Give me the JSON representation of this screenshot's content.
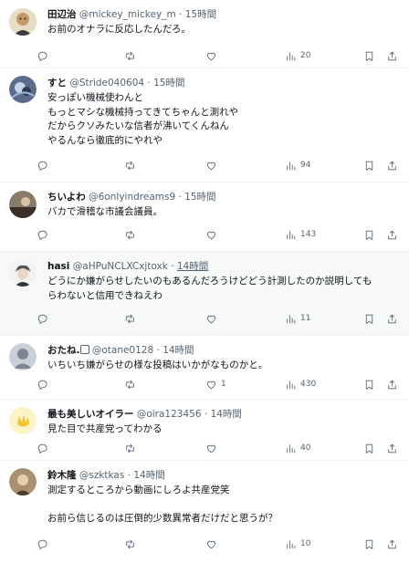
{
  "replies": [
    {
      "name": "田辺治",
      "handle": "@mickey_mickey_m",
      "dot": "·",
      "time": "15時間",
      "text": "お前のオナラに反応したんだろ。",
      "replies": "",
      "retweets": "",
      "likes": "",
      "views": "20"
    },
    {
      "name": "すと",
      "handle": "@Stride040604",
      "dot": "·",
      "time": "15時間",
      "text": "安っぽい機械使わんと\nもっとマシな機械持ってきてちゃんと測れや\nだからクソみたいな信者が沸いてくんねん\nやるんなら徹底的にやれや",
      "replies": "",
      "retweets": "",
      "likes": "",
      "views": "94"
    },
    {
      "name": "ちいよわ",
      "handle": "@6onlyindreams9",
      "dot": "·",
      "time": "15時間",
      "text": "バカで滑稽な市議会議員。",
      "replies": "",
      "retweets": "",
      "likes": "",
      "views": "143"
    },
    {
      "name": "hasi",
      "handle": "@aHPuNCLXCxjtoxk",
      "dot": "·",
      "time": "14時間",
      "text": "どうにか嫌がらせしたいのもあるんだろうけどどう計測したのか説明しても\nらわないと信用できねえわ",
      "replies": "",
      "retweets": "",
      "likes": "",
      "views": "11"
    },
    {
      "name": "おたね.",
      "handle": "@otane0128",
      "dot": "·",
      "time": "14時間",
      "text": "いちいち嫌がらせの様な投稿はいかがなものかと。",
      "replies": "",
      "retweets": "",
      "likes": "1",
      "views": "430"
    },
    {
      "name": "最も美しいオイラー",
      "handle": "@oira123456",
      "dot": "·",
      "time": "14時間",
      "text": "見た目で共産党ってわかる",
      "replies": "",
      "retweets": "",
      "likes": "",
      "views": "40"
    },
    {
      "name": "鈴木隆",
      "handle": "@szktkas",
      "dot": "·",
      "time": "14時間",
      "text": "測定するところから動画にしろよ共産党笑\n\nお前ら信じるのは圧倒的少数異常者だけだと思うが？",
      "replies": "",
      "retweets": "",
      "likes": "",
      "views": "10"
    }
  ],
  "icons": {
    "reply": "reply-icon",
    "retweet": "retweet-icon",
    "like": "heart-icon",
    "views": "views-icon",
    "bookmark": "bookmark-icon",
    "share": "share-icon"
  },
  "colors": {
    "text": "#0f1419",
    "muted": "#536471",
    "divider": "#eff3f4",
    "highlight": "#f7f9f9"
  }
}
